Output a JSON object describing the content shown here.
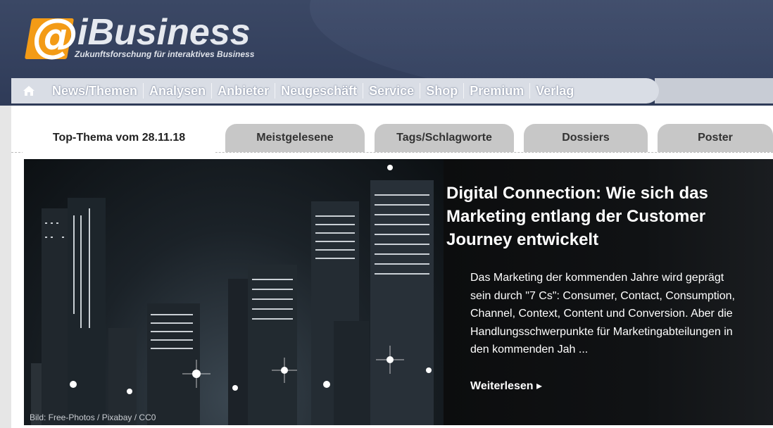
{
  "brand": {
    "logo_mark": "@",
    "name": "iBusiness",
    "tagline": "Zukunftsforschung für interaktives Business"
  },
  "nav": {
    "home_icon": "home-icon",
    "items": [
      "News/Themen",
      "Analysen",
      "Anbieter",
      "Neugeschäft",
      "Service",
      "Shop",
      "Premium",
      "Verlag"
    ]
  },
  "tabs": [
    "Top-Thema vom 28.11.18",
    "Meistgelesene",
    "Tags/Schlagworte",
    "Dossiers",
    "Poster"
  ],
  "feature": {
    "headline": "Digital Connection: Wie sich das Marketing entlang der Customer Journey entwickelt",
    "teaser": "Das Marketing der kommenden Jahre wird geprägt sein durch \"7 Cs\": Consumer, Contact, Consumption, Channel, Context, Content und Conversion. Aber die Handlungsschwerpunkte für Marketingabteilungen in den kommenden Jah ...",
    "more_label": "Weiterlesen",
    "image_credit": "Bild: Free-Photos / Pixabay / CC0"
  },
  "colors": {
    "header_bg": "#323f5c",
    "logo_orange": "#f39b16",
    "nav_bg": "#d9dde5",
    "tab_inactive": "#c7c7c7"
  }
}
